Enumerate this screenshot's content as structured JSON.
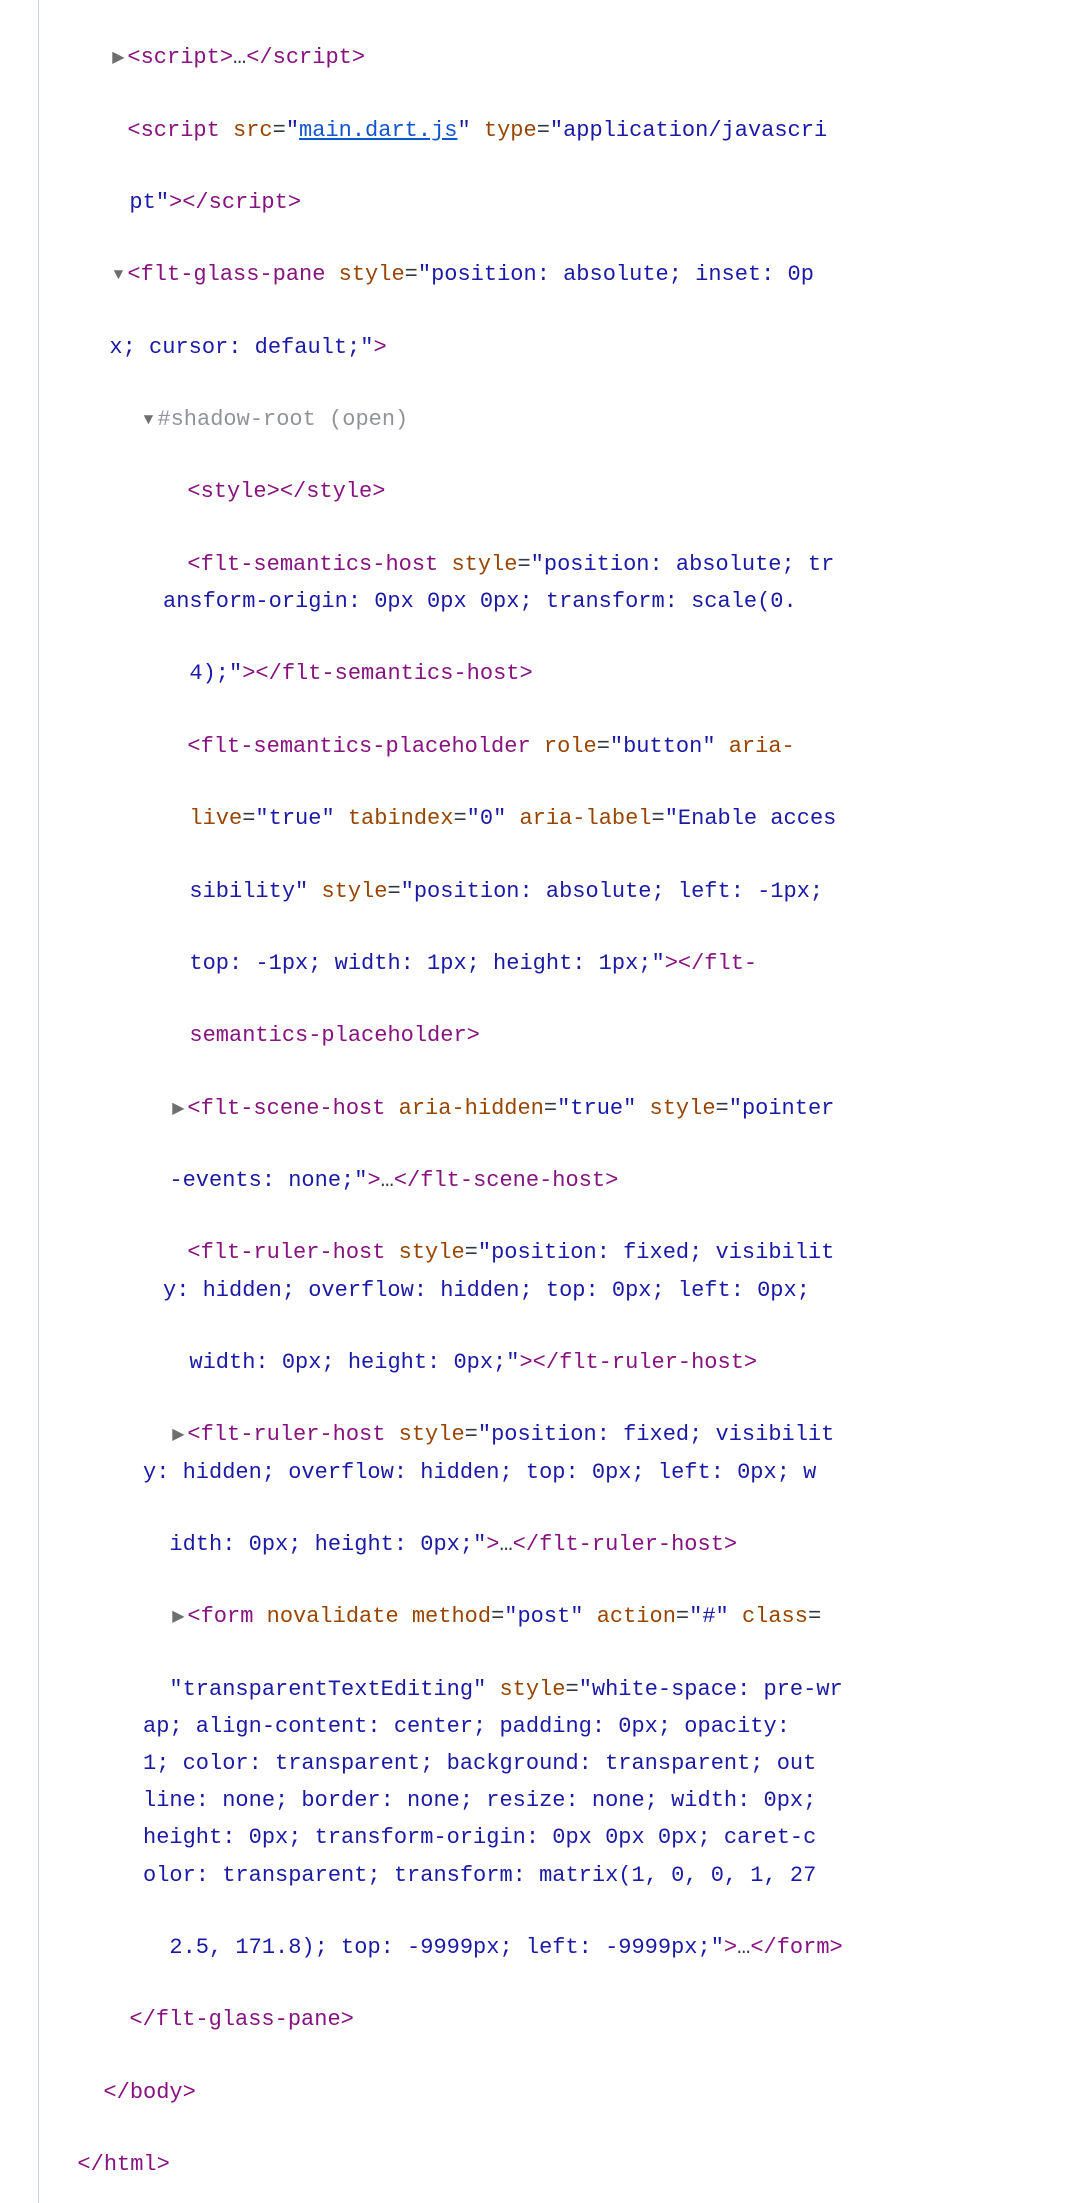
{
  "l1": {
    "open": "<",
    "tag": "script",
    "close": ">",
    "ell": "…",
    "open2": "</",
    "tag2": "script",
    "close2": ">"
  },
  "l2": {
    "open": "<",
    "tag": "script",
    "sp": " ",
    "a1": "src",
    "eq": "=",
    "q": "\"",
    "v1": "main.dart.js",
    "a2": "type",
    "v2": "application/javascri"
  },
  "l2b": {
    "cont": "pt",
    "q": "\"",
    "close": ">",
    "open2": "</",
    "tag": "script",
    "close2": ">"
  },
  "l3": {
    "open": "<",
    "tag": "flt-glass-pane",
    "sp": " ",
    "a1": "style",
    "eq": "=",
    "q": "\"",
    "v": "position: absolute; inset: 0p"
  },
  "l3b": {
    "cont": "x; cursor: default;",
    "q": "\"",
    "close": ">"
  },
  "l4": {
    "text": "#shadow-root (open)"
  },
  "l5": {
    "open": "<",
    "tag": "style",
    "close": ">",
    "open2": "</",
    "tag2": "style",
    "close2": ">"
  },
  "l6a": {
    "open": "<",
    "tag": "flt-semantics-host",
    "sp": " ",
    "a1": "style",
    "eq": "=",
    "q": "\"",
    "v": "position: absolute; tr"
  },
  "l6b": {
    "v": "ansform-origin: 0px 0px 0px; transform: scale(0."
  },
  "l6c": {
    "v": "4);",
    "q": "\"",
    "close": ">",
    "open2": "</",
    "tag": "flt-semantics-host",
    "close2": ">"
  },
  "l7a": {
    "open": "<",
    "tag": "flt-semantics-placeholder",
    "sp": " ",
    "a1": "role",
    "eq": "=",
    "q": "\"",
    "v1": "button",
    "a2": "aria-"
  },
  "l7b": {
    "a1": "live",
    "eq": "=",
    "q": "\"",
    "v1": "true",
    "a2": "tabindex",
    "v2": "0",
    "a3": "aria-label",
    "v3": "Enable acces"
  },
  "l7c": {
    "v1": "sibility",
    "q": "\"",
    "a1": "style",
    "eq": "=",
    "v2": "position: absolute; left: -1px;"
  },
  "l7d": {
    "v": "top: -1px; width: 1px; height: 1px;",
    "q": "\"",
    "close": ">",
    "open2": "</",
    "tag": "flt-"
  },
  "l7e": {
    "tag": "semantics-placeholder",
    "close": ">"
  },
  "l8a": {
    "open": "<",
    "tag": "flt-scene-host",
    "sp": " ",
    "a1": "aria-hidden",
    "eq": "=",
    "q": "\"",
    "v1": "true",
    "a2": "style",
    "v2": "pointer"
  },
  "l8b": {
    "v": "-events: none;",
    "q": "\"",
    "close": ">",
    "ell": "…",
    "open2": "</",
    "tag": "flt-scene-host",
    "close2": ">"
  },
  "l9a": {
    "open": "<",
    "tag": "flt-ruler-host",
    "sp": " ",
    "a1": "style",
    "eq": "=",
    "q": "\"",
    "v": "position: fixed; visibilit"
  },
  "l9b": {
    "v": "y: hidden; overflow: hidden; top: 0px; left: 0px;"
  },
  "l9c": {
    "v": "width: 0px; height: 0px;",
    "q": "\"",
    "close": ">",
    "open2": "</",
    "tag": "flt-ruler-host",
    "close2": ">"
  },
  "l10a": {
    "open": "<",
    "tag": "flt-ruler-host",
    "sp": " ",
    "a1": "style",
    "eq": "=",
    "q": "\"",
    "v": "position: fixed; visibilit"
  },
  "l10b": {
    "v": "y: hidden; overflow: hidden; top: 0px; left: 0px; w"
  },
  "l10c": {
    "v": "idth: 0px; height: 0px;",
    "q": "\"",
    "close": ">",
    "ell": "…",
    "open2": "</",
    "tag": "flt-ruler-host",
    "close2": ">"
  },
  "l11a": {
    "open": "<",
    "tag": "form",
    "sp": " ",
    "a1": "novalidate",
    "a2": "method",
    "eq": "=",
    "q": "\"",
    "v1": "post",
    "a3": "action",
    "v2": "#",
    "a4": "class"
  },
  "l11b": {
    "q": "\"",
    "v1": "transparentTextEditing",
    "a1": "style",
    "eq": "=",
    "v2": "white-space: pre-wr"
  },
  "l11c": {
    "v": "ap; align-content: center; padding: 0px; opacity:"
  },
  "l11d": {
    "v": "1; color: transparent; background: transparent; out"
  },
  "l11e": {
    "v": "line: none; border: none; resize: none; width: 0px;"
  },
  "l11f": {
    "v": "height: 0px; transform-origin: 0px 0px 0px; caret-c"
  },
  "l11g": {
    "v": "olor: transparent; transform: matrix(1, 0, 0, 1, 27"
  },
  "l11h": {
    "v": "2.5, 171.8); top: -9999px; left: -9999px;",
    "q": "\"",
    "close": ">",
    "ell": "…",
    "open2": "</",
    "tag": "form",
    "close2": ">"
  },
  "l12": {
    "open": "</",
    "tag": "flt-glass-pane",
    "close": ">"
  },
  "l13": {
    "open": "</",
    "tag": "body",
    "close": ">"
  },
  "l14": {
    "open": "</",
    "tag": "html",
    "close": ">"
  }
}
